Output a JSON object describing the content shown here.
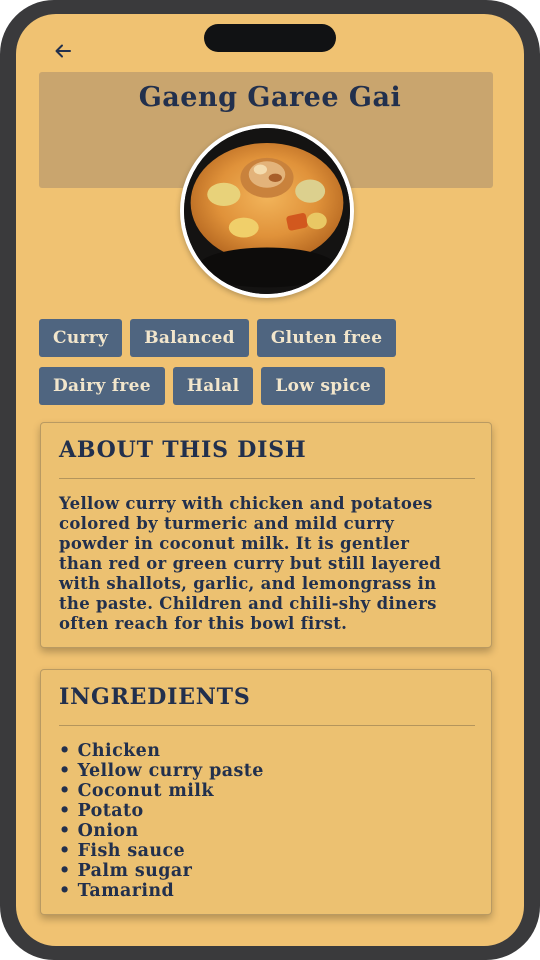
{
  "dish": {
    "title": "Gaeng Garee Gai"
  },
  "tags": [
    [
      "Curry",
      "Balanced",
      "Gluten free"
    ],
    [
      "Dairy free",
      "Halal",
      "Low spice"
    ]
  ],
  "about": {
    "heading": "ABOUT THIS DISH",
    "lines": [
      "Yellow curry with chicken and potatoes",
      "colored by turmeric and mild curry",
      "powder in coconut milk. It is gentler",
      "than red or green curry but still layered",
      "with shallots, garlic, and lemongrass in",
      "the paste. Children and chili-shy diners",
      "often reach for this bowl first."
    ]
  },
  "ingredients": {
    "heading": "INGREDIENTS",
    "items": [
      "Chicken",
      "Yellow curry paste",
      "Coconut milk",
      "Potato",
      "Onion",
      "Fish sauce",
      "Palm sugar",
      "Tamarind"
    ]
  },
  "icons": {
    "back": "arrow-left-icon"
  },
  "colors": {
    "screen": "#f0c272",
    "title_panel": "#c9a56e",
    "tag": "#4f6580",
    "text": "#22304d"
  }
}
